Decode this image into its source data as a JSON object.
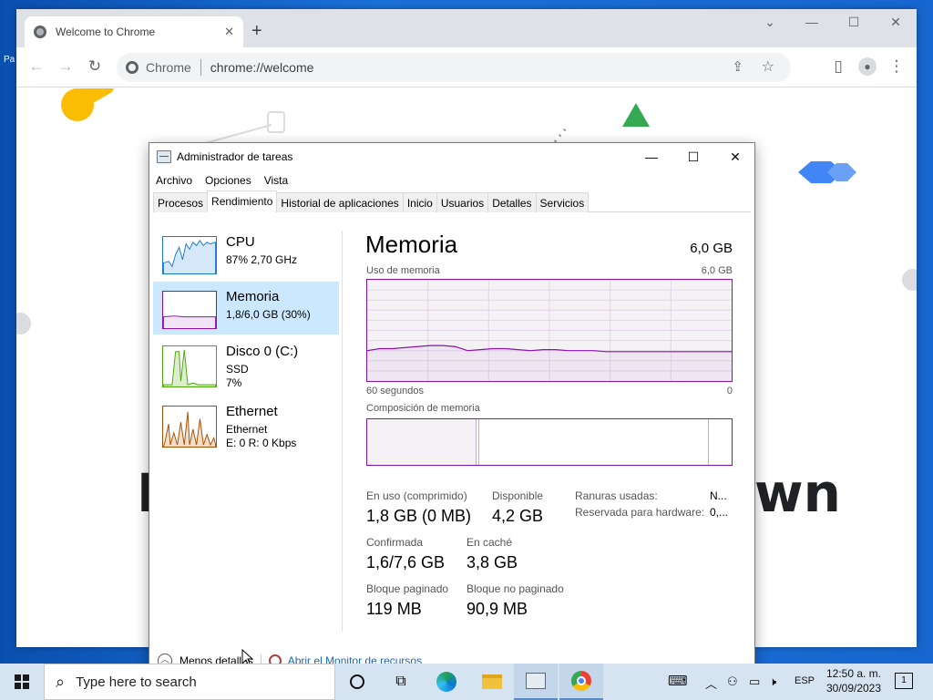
{
  "chrome": {
    "tab_title": "Welcome to Chrome",
    "site_label": "Chrome",
    "url": "chrome://welcome",
    "page_big_left": "I",
    "page_big_right": "wn"
  },
  "task_manager": {
    "title": "Administrador de tareas",
    "menu": [
      "Archivo",
      "Opciones",
      "Vista"
    ],
    "tabs": [
      "Procesos",
      "Rendimiento",
      "Historial de aplicaciones",
      "Inicio",
      "Usuarios",
      "Detalles",
      "Servicios"
    ],
    "active_tab": "Rendimiento",
    "sidebar": [
      {
        "name": "CPU",
        "sub1": "87% 2,70 GHz",
        "sub2": "",
        "color": "#1979ca"
      },
      {
        "name": "Memoria",
        "sub1": "1,8/6,0 GB (30%)",
        "sub2": "",
        "color": "#8b12ae"
      },
      {
        "name": "Disco 0 (C:)",
        "sub1": "SSD",
        "sub2": "7%",
        "color": "#4da60c"
      },
      {
        "name": "Ethernet",
        "sub1": "Ethernet",
        "sub2": "E: 0 R: 0 Kbps",
        "color": "#a74f01"
      }
    ],
    "memory": {
      "title": "Memoria",
      "total": "6,0 GB",
      "usage_label": "Uso de memoria",
      "usage_max": "6,0 GB",
      "time_left": "60 segundos",
      "time_right": "0",
      "composition_label": "Composición de memoria",
      "stats": {
        "in_use_label": "En uso (comprimido)",
        "in_use_value": "1,8 GB (0 MB)",
        "available_label": "Disponible",
        "available_value": "4,2 GB",
        "committed_label": "Confirmada",
        "committed_value": "1,6/7,6 GB",
        "cached_label": "En caché",
        "cached_value": "3,8 GB",
        "paged_label": "Bloque paginado",
        "paged_value": "119 MB",
        "nonpaged_label": "Bloque no paginado",
        "nonpaged_value": "90,9 MB",
        "slots_label": "Ranuras usadas:",
        "slots_value": "N...",
        "reserved_label": "Reservada para hardware:",
        "reserved_value": "0,..."
      },
      "usage_series": [
        0.3,
        0.32,
        0.32,
        0.33,
        0.34,
        0.35,
        0.35,
        0.34,
        0.3,
        0.31,
        0.32,
        0.32,
        0.31,
        0.3,
        0.31,
        0.31,
        0.3,
        0.3,
        0.3,
        0.29,
        0.29,
        0.29,
        0.29,
        0.29,
        0.29,
        0.29,
        0.29,
        0.29,
        0.29,
        0.29
      ],
      "composition_in_use_fraction": 0.3
    },
    "bottom": {
      "less_details": "Menos detalles",
      "monitor_link": "Abrir el Monitor de recursos"
    }
  },
  "taskbar": {
    "search_placeholder": "Type here to search",
    "lang": "ESP",
    "time": "12:50 a. m.",
    "date": "30/09/2023",
    "notif_count": "1"
  }
}
